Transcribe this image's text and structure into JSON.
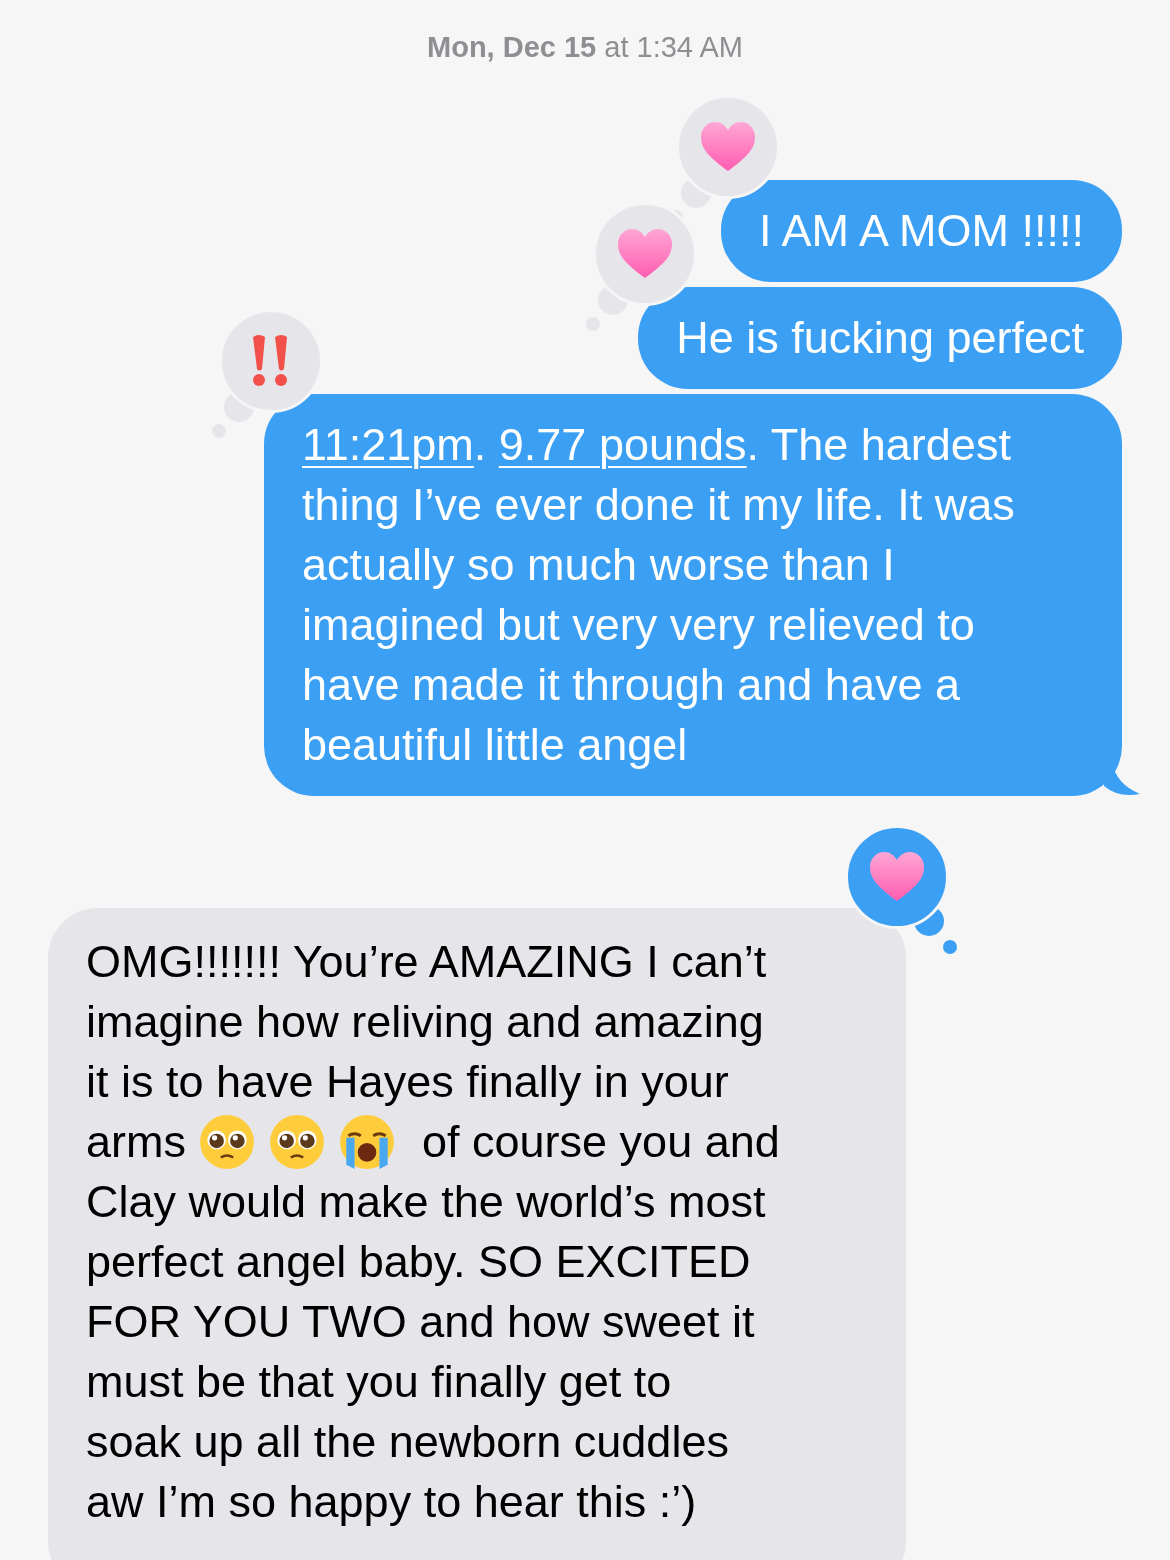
{
  "timestamp": "**Mon, Dec 15** at 1:34 AM",
  "messages": [
    {
      "kind": "sent",
      "parts": [
        {
          "kind": "text",
          "text": "I AM A MOM !!!!!"
        }
      ],
      "tapback": {
        "kind": "heart",
        "mine": false
      },
      "tail": false
    },
    {
      "kind": "sent",
      "parts": [
        {
          "kind": "text",
          "text": "He is fucking perfect"
        }
      ],
      "tapback": {
        "kind": "heart",
        "mine": false
      },
      "tail": false
    },
    {
      "kind": "sent",
      "parts": [
        {
          "kind": "link",
          "text": "11:21pm"
        },
        {
          "kind": "text",
          "text": ". "
        },
        {
          "kind": "link",
          "text": "9.77 pounds"
        },
        {
          "kind": "text",
          "text": ". The hardest thing I’ve ever done it my life. It was actually so much worse than I imagined but very very relieved to have made it through and have a beautiful little angel"
        }
      ],
      "tapback": {
        "kind": "exclamation",
        "mine": false
      },
      "tail": true
    },
    {
      "kind": "received",
      "lines": [
        [
          {
            "kind": "text",
            "text": "OMG!!!!!!! You’re AMAZING I can’t"
          }
        ],
        [
          {
            "kind": "text",
            "text": "imagine how reliving and amazing"
          }
        ],
        [
          {
            "kind": "text",
            "text": "it is to have Hayes finally in your"
          }
        ],
        [
          {
            "kind": "text",
            "text": "arms"
          },
          {
            "kind": "pleading_emoji"
          },
          {
            "kind": "pleading_emoji"
          },
          {
            "kind": "crying_emoji"
          },
          {
            "kind": "text",
            "text": "of course you and"
          }
        ],
        [
          {
            "kind": "text",
            "text": "Clay would make the world’s most"
          }
        ],
        [
          {
            "kind": "text",
            "text": "perfect angel baby. SO EXCITED"
          }
        ],
        [
          {
            "kind": "text",
            "text": "FOR YOU TWO and how sweet it"
          }
        ],
        [
          {
            "kind": "text",
            "text": "must be that you finally get to"
          }
        ],
        [
          {
            "kind": "text",
            "text": "soak up all the newborn cuddles"
          }
        ],
        [
          {
            "kind": "text",
            "text": "aw I’m so happy to hear this :’)"
          }
        ]
      ],
      "tapback": {
        "kind": "heart",
        "mine": true
      },
      "tail": false
    }
  ]
}
